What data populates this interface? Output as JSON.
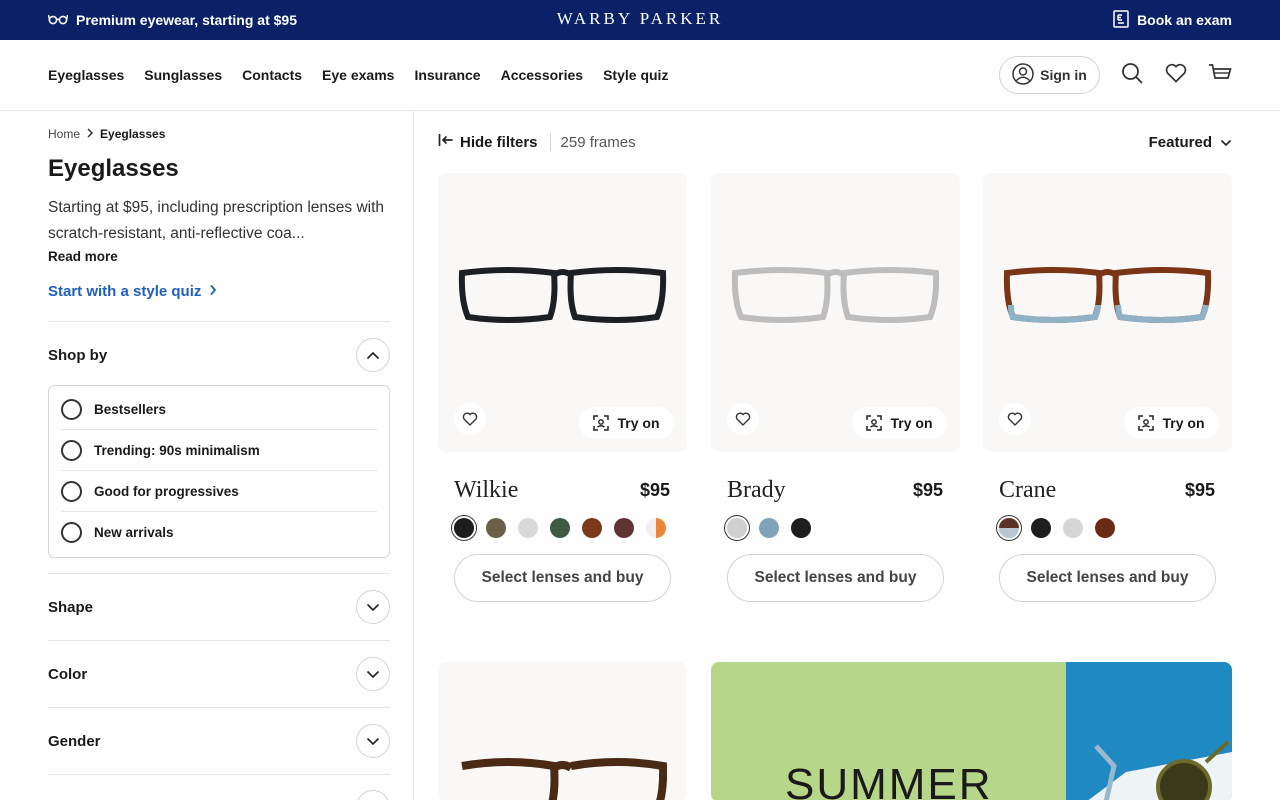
{
  "promo": {
    "left_text": "Premium eyewear, starting at $95",
    "logo": "WARBY PARKER",
    "right_text": "Book an exam"
  },
  "nav": {
    "links": [
      "Eyeglasses",
      "Sunglasses",
      "Contacts",
      "Eye exams",
      "Insurance",
      "Accessories",
      "Style quiz"
    ],
    "sign_in": "Sign in"
  },
  "sidebar": {
    "breadcrumb": [
      "Home",
      "Eyeglasses"
    ],
    "title": "Eyeglasses",
    "description": "Starting at $95, including prescription lenses with scratch-resistant, anti-reflective coa...",
    "read_more": "Read more",
    "style_quiz": "Start with a style quiz",
    "shop_by": {
      "label": "Shop by",
      "options": [
        "Bestsellers",
        "Trending: 90s minimalism",
        "Good for progressives",
        "New arrivals"
      ]
    },
    "filters": [
      "Shape",
      "Color",
      "Gender"
    ]
  },
  "toolbar": {
    "hide_filters": "Hide filters",
    "count": "259 frames",
    "sort": "Featured"
  },
  "products": [
    {
      "name": "Wilkie",
      "price": "$95",
      "try_on": "Try on",
      "buy": "Select lenses and buy",
      "frame_color": "#1c1f24",
      "swatches": [
        "#1c1c1c",
        "#6b6048",
        "#d9d9d9",
        "#3f5a42",
        "#7a3a1a",
        "#5e3433",
        "#e9873a"
      ]
    },
    {
      "name": "Brady",
      "price": "$95",
      "try_on": "Try on",
      "buy": "Select lenses and buy",
      "frame_color": "#bdbdbd",
      "swatches": [
        "#cfcfcf",
        "#7fa3b8",
        "#1e1e1e"
      ]
    },
    {
      "name": "Crane",
      "price": "$95",
      "try_on": "Try on",
      "buy": "Select lenses and buy",
      "frame_color": "#7a3416",
      "swatches": [
        "#5a3326",
        "#1e1e1e",
        "#d6d6d6",
        "#6b2a14"
      ]
    }
  ],
  "banner": {
    "text": "SUMMER"
  },
  "colors": {
    "promo_bg": "#0b2167",
    "link_blue": "#1f5fbf",
    "banner_green": "#b6d78a",
    "banner_blue": "#1f8ac2"
  }
}
